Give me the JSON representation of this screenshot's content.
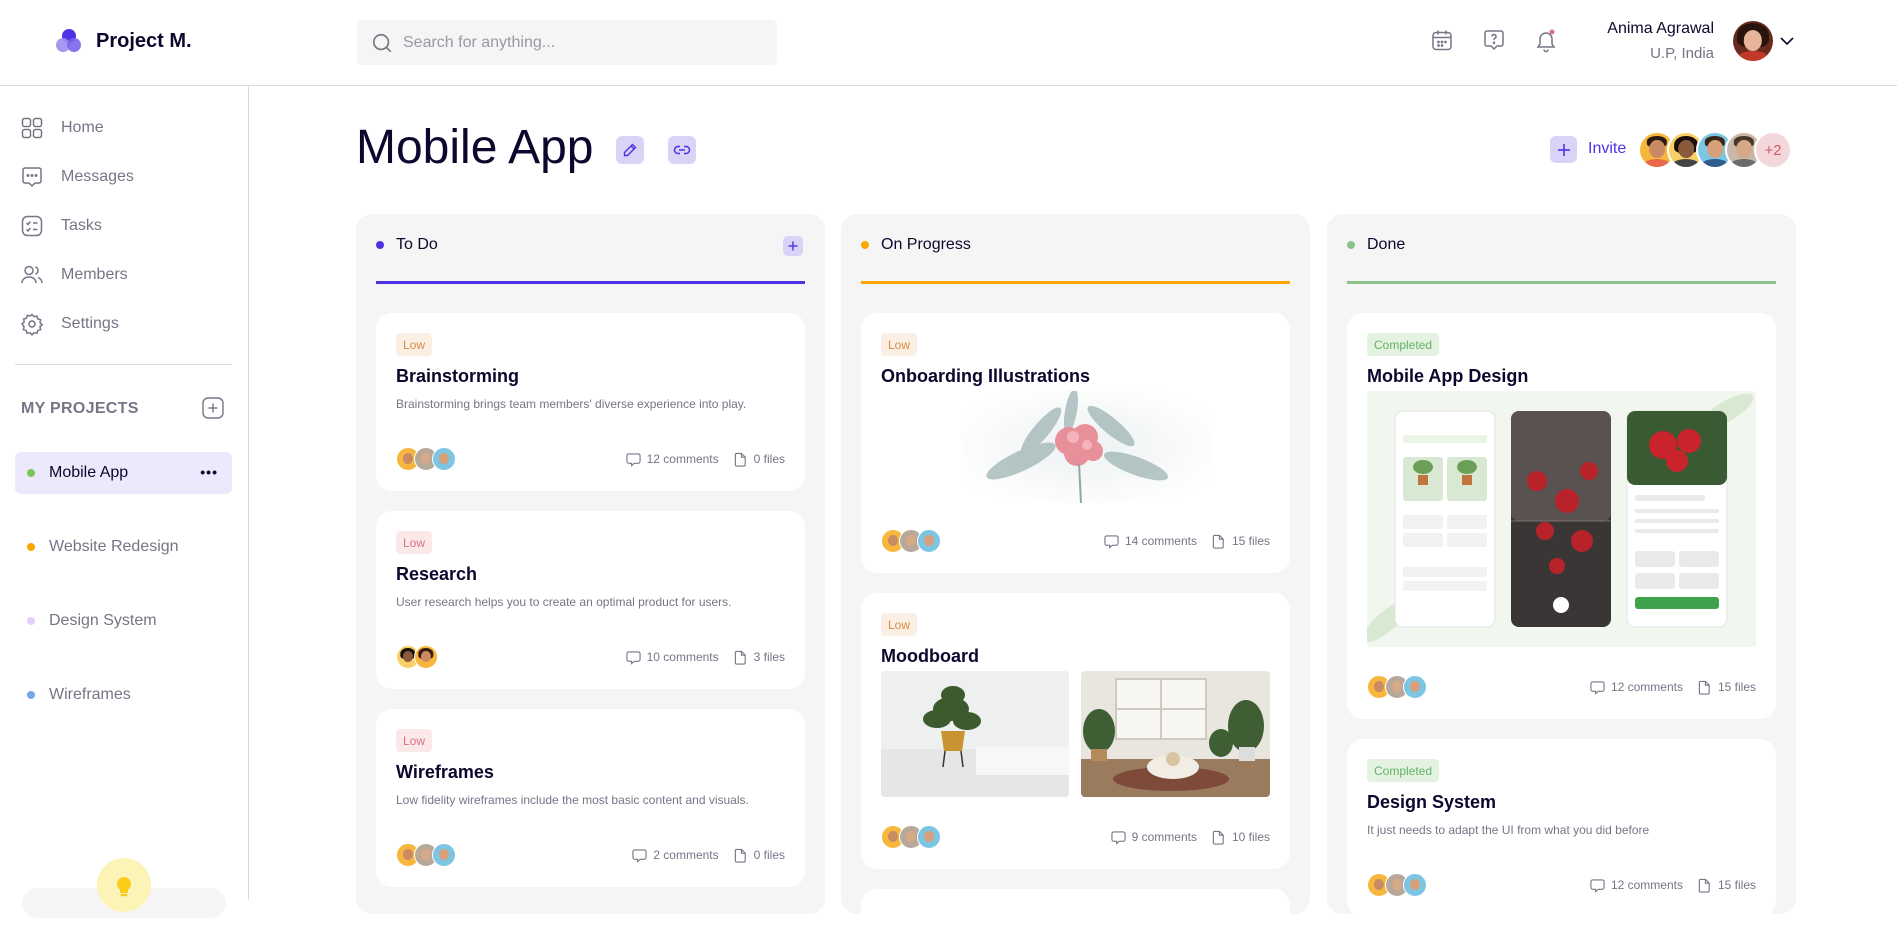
{
  "app": {
    "brand": "Project M."
  },
  "search": {
    "placeholder": "Search for anything..."
  },
  "header": {
    "icons": [
      "calendar-icon",
      "help-icon",
      "bell-icon"
    ]
  },
  "user": {
    "name": "Anima Agrawal",
    "location": "U.P, India"
  },
  "sidebar": {
    "items": [
      {
        "label": "Home",
        "icon": "grid-icon"
      },
      {
        "label": "Messages",
        "icon": "message-icon"
      },
      {
        "label": "Tasks",
        "icon": "tasks-icon"
      },
      {
        "label": "Members",
        "icon": "members-icon"
      },
      {
        "label": "Settings",
        "icon": "settings-icon"
      }
    ],
    "projects_heading": "MY PROJECTS",
    "projects": [
      {
        "label": "Mobile App",
        "color": "#7ac555",
        "active": true
      },
      {
        "label": "Website Redesign",
        "color": "#ffa500"
      },
      {
        "label": "Design System",
        "color": "#e4ccfd"
      },
      {
        "label": "Wireframes",
        "color": "#76a5ea"
      }
    ]
  },
  "page": {
    "title": "Mobile App",
    "invite_label": "Invite",
    "team_more": "+2"
  },
  "columns": [
    {
      "title": "To Do",
      "color": "#5030e5",
      "cards": [
        {
          "priority": "Low",
          "title": "Brainstorming",
          "desc": "Brainstorming brings team members' diverse experience into play.",
          "comments": "12 comments",
          "files": "0 files"
        },
        {
          "priority": "Low",
          "title": "Research",
          "desc": "User research helps you to create an optimal product for users.",
          "comments": "10 comments",
          "files": "3 files"
        },
        {
          "priority": "Low",
          "title": "Wireframes",
          "desc": "Low fidelity wireframes include the most basic content and visuals.",
          "comments": "2 comments",
          "files": "0 files"
        }
      ]
    },
    {
      "title": "On Progress",
      "color": "#ffa500",
      "cards": [
        {
          "priority": "Low",
          "title": "Onboarding Illustrations",
          "comments": "14 comments",
          "files": "15 files"
        },
        {
          "priority": "Low",
          "title": "Moodboard",
          "comments": "9 comments",
          "files": "10 files"
        }
      ]
    },
    {
      "title": "Done",
      "color": "#8bc48a",
      "cards": [
        {
          "priority": "Completed",
          "title": "Mobile App Design",
          "comments": "12 comments",
          "files": "15 files"
        },
        {
          "priority": "Completed",
          "title": "Design System",
          "desc": "It just needs to adapt the UI from what you did before",
          "comments": "12 comments",
          "files": "15 files"
        }
      ]
    }
  ]
}
